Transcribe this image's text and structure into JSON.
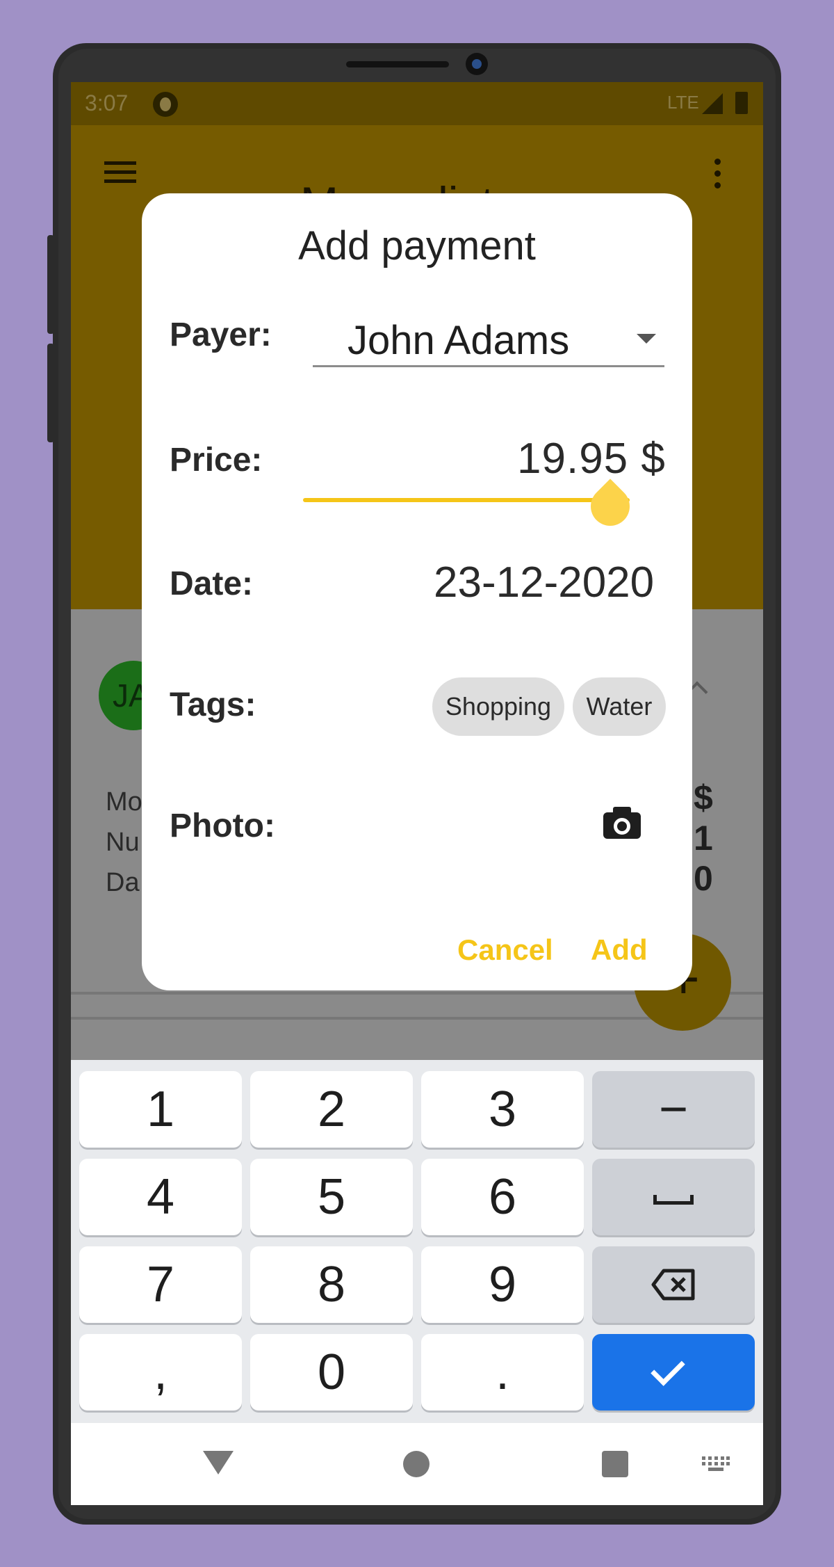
{
  "status_bar": {
    "time": "3:07",
    "network": "LTE"
  },
  "app": {
    "title": "Moneylist",
    "avatar_initials": "JA",
    "bg_labels": [
      "Mo",
      "Nu",
      "Da"
    ],
    "bg_values": [
      "$",
      "1",
      "0"
    ]
  },
  "dialog": {
    "title": "Add payment",
    "payer": {
      "label": "Payer:",
      "value": "John Adams"
    },
    "price": {
      "label": "Price:",
      "value": "19.95",
      "currency": "$",
      "slider_fraction": 0.94
    },
    "date": {
      "label": "Date:",
      "value": "23-12-2020"
    },
    "tags": {
      "label": "Tags:",
      "items": [
        "Shopping",
        "Water"
      ]
    },
    "photo": {
      "label": "Photo:",
      "icon": "camera-icon"
    },
    "cancel_label": "Cancel",
    "add_label": "Add"
  },
  "keyboard": {
    "rows": [
      [
        "1",
        "2",
        "3",
        "−"
      ],
      [
        "4",
        "5",
        "6",
        "space"
      ],
      [
        "7",
        "8",
        "9",
        "backspace"
      ],
      [
        ",",
        "0",
        ".",
        "enter"
      ]
    ],
    "enter_color": "#1a73e8"
  },
  "colors": {
    "accent": "#f5c518",
    "app_bar_dimmed": "#765b00",
    "background": "#a091c6"
  }
}
